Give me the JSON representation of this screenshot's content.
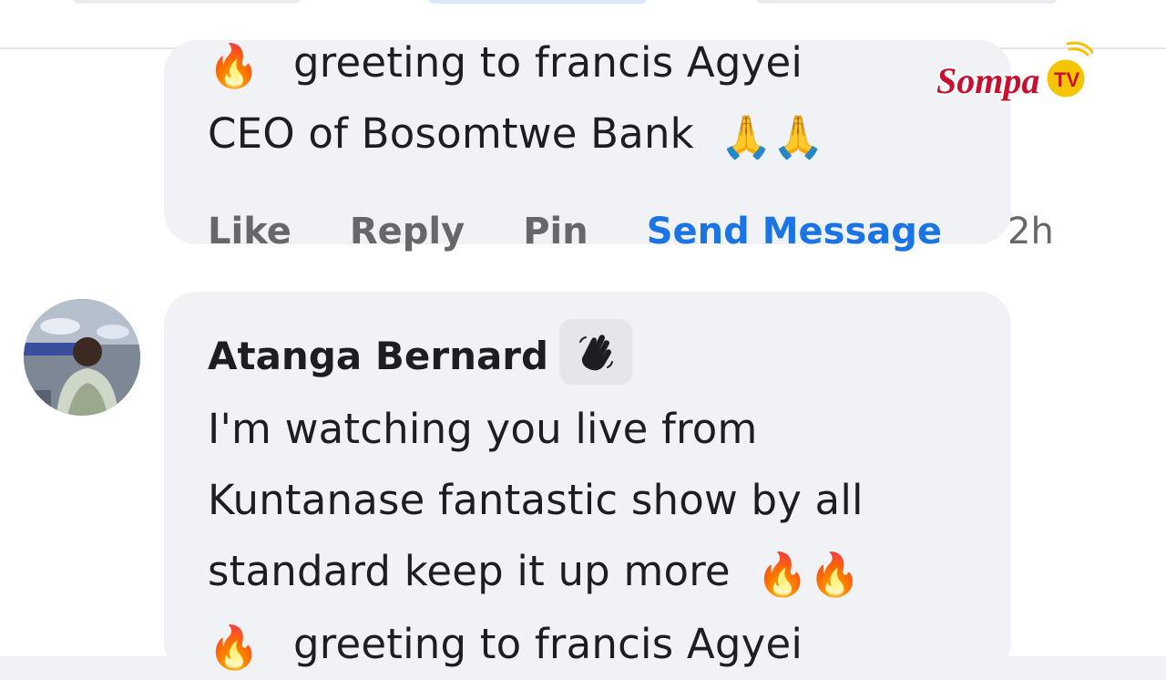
{
  "prev_comment": {
    "line1": "greeting to francis Agyei",
    "line2": "CEO of Bosomtwe Bank",
    "line1_emoji": "🔥",
    "line2_emoji": "🙏🙏"
  },
  "actions": {
    "like": "Like",
    "reply": "Reply",
    "pin": "Pin",
    "send_message": "Send Message",
    "time": "2h"
  },
  "comment": {
    "author": "Atanga Bernard",
    "badge_icon": "wave-hand-icon",
    "lines": [
      "I'm watching you live from",
      "Kuntanase fantastic show by all",
      "standard keep it up more"
    ],
    "line3_emoji": "🔥🔥",
    "line4_emoji": "🔥",
    "line4": "greeting to francis Agyei"
  },
  "watermark": {
    "brand": "Sompa",
    "tv": "TV"
  },
  "colors": {
    "link_blue": "#1b74e4",
    "bubble_bg": "#f0f2f5",
    "muted": "#65676b",
    "brand_red": "#c8102e",
    "brand_yellow": "#f5c400"
  }
}
